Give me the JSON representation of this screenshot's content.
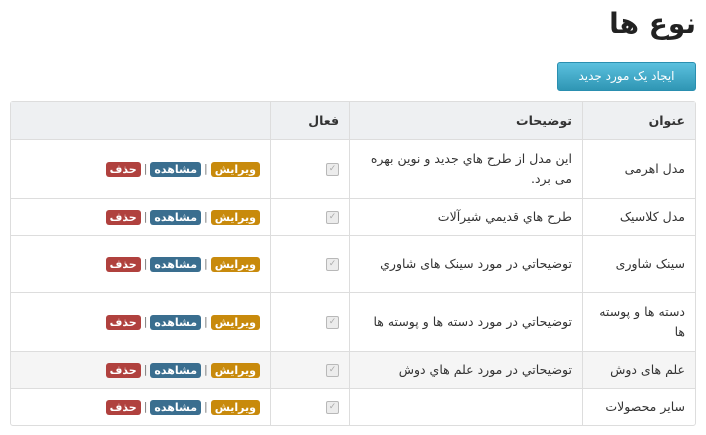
{
  "page": {
    "title": "نوع ها",
    "create_button": "ایجاد یک مورد جدید"
  },
  "table": {
    "headers": {
      "title": "عنوان",
      "description": "توضیحات",
      "active": "فعال",
      "actions": ""
    },
    "action_labels": {
      "edit": "ویرایش",
      "view": "مشاهده",
      "delete": "حذف",
      "separator": "|"
    },
    "checkbox_glyph": "✓",
    "rows": [
      {
        "title": "مدل اهرمی",
        "description": "این مدل از طرح هاي جدید و نوين بهره می برد.",
        "active": true
      },
      {
        "title": "مدل کلاسیک",
        "description": "طرح هاي قديمي شيرآلات",
        "active": true
      },
      {
        "title": "سینک شاوری",
        "description": "توضیحاتي در مورد سینک های شاوري",
        "active": true
      },
      {
        "title": "دسته ها و پوسته ها",
        "description": "توضیحاتي در مورد  دسته ها و پوسته ها",
        "active": true
      },
      {
        "title": "علم های دوش",
        "description": "توضیحاتي در مورد علم هاي دوش",
        "active": true
      },
      {
        "title": "سایر محصولات",
        "description": "",
        "active": true
      }
    ]
  },
  "colors": {
    "primary_button": "#49afcd",
    "edit_label": "#c88a0c",
    "view_label": "#3a6e8f",
    "delete_label": "#b0413e"
  }
}
